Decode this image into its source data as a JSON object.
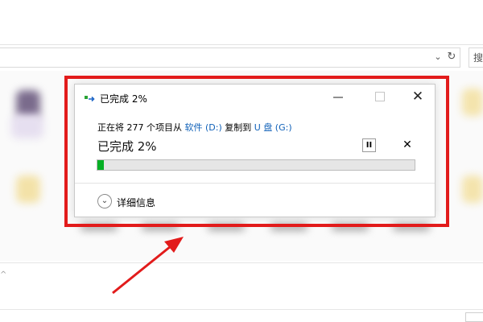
{
  "explorer": {
    "search_label": "搜",
    "bottom_mark": "^"
  },
  "dialog": {
    "title": "已完成 2%",
    "desc_prefix": "正在将 277 个项目从 ",
    "source": "软件 (D:)",
    "desc_middle": " 复制到 ",
    "destination": "U 盘 (G:)",
    "percent_label": "已完成 2%",
    "progress": 0.02,
    "details_label": "详细信息"
  },
  "colors": {
    "accent_link": "#0f60b8",
    "progress_fill": "#06b025",
    "annotation": "#e21b1b"
  },
  "icons": {
    "copy": "copy-transfer-icon",
    "minimize": "minimize-icon",
    "maximize": "maximize-icon",
    "close": "close-icon",
    "pause": "pause-icon",
    "stop": "stop-icon",
    "details": "chevron-down-icon"
  }
}
